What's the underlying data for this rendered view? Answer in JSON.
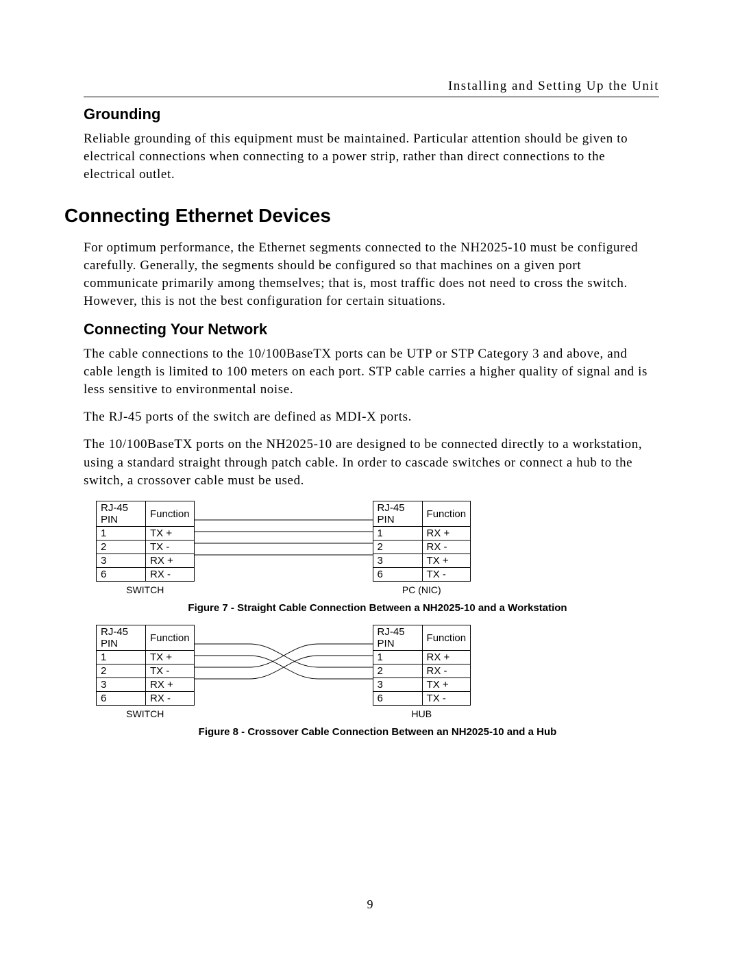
{
  "header": {
    "running_title": "Installing and Setting Up the Unit"
  },
  "sections": {
    "grounding": {
      "title": "Grounding",
      "p1": "Reliable grounding of this equipment must be maintained.  Particular attention should be given to electrical connections when connecting to a power strip, rather than direct connections to the electrical outlet."
    },
    "connecting_devices": {
      "title": "Connecting Ethernet Devices",
      "p1": "For optimum performance, the Ethernet segments connected to the NH2025-10 must be configured carefully.  Generally, the segments should be configured so that machines on a given port communicate primarily among themselves; that is, most traffic does not need to cross the switch.  However, this is not the best configuration for certain situations."
    },
    "connecting_network": {
      "title": "Connecting Your Network",
      "p1": "The cable connections to the 10/100BaseTX ports can be UTP or STP Category 3 and above, and cable length is limited to 100 meters on each port. STP cable carries a higher quality of signal and is less sensitive to environmental noise.",
      "p2": "The RJ-45 ports of the switch are defined as MDI-X ports.",
      "p3": "The 10/100BaseTX ports on the NH2025-10 are designed to be connected directly to a workstation, using a standard straight through patch cable. In order to cascade switches or connect a hub to the switch, a crossover cable must be used."
    }
  },
  "table_headers": {
    "pin": "RJ-45 PIN",
    "fn": "Function"
  },
  "labels": {
    "switch": "SWITCH",
    "pc": "PC (NIC)",
    "hub": "HUB"
  },
  "figures": {
    "fig7": {
      "left": {
        "sub": "SWITCH",
        "rows": [
          {
            "pin": "1",
            "fn": "TX +"
          },
          {
            "pin": "2",
            "fn": "TX -"
          },
          {
            "pin": "3",
            "fn": "RX +"
          },
          {
            "pin": "6",
            "fn": "RX -"
          }
        ]
      },
      "right": {
        "sub": "PC (NIC)",
        "rows": [
          {
            "pin": "1",
            "fn": "RX +"
          },
          {
            "pin": "2",
            "fn": "RX -"
          },
          {
            "pin": "3",
            "fn": "TX +"
          },
          {
            "pin": "6",
            "fn": "TX -"
          }
        ]
      },
      "caption": "Figure 7 - Straight Cable Connection Between a NH2025-10 and a Workstation"
    },
    "fig8": {
      "left": {
        "sub": "SWITCH",
        "rows": [
          {
            "pin": "1",
            "fn": "TX +"
          },
          {
            "pin": "2",
            "fn": "TX -"
          },
          {
            "pin": "3",
            "fn": "RX +"
          },
          {
            "pin": "6",
            "fn": "RX -"
          }
        ]
      },
      "right": {
        "sub": "HUB",
        "rows": [
          {
            "pin": "1",
            "fn": "RX +"
          },
          {
            "pin": "2",
            "fn": "RX -"
          },
          {
            "pin": "3",
            "fn": "TX +"
          },
          {
            "pin": "6",
            "fn": "TX -"
          }
        ]
      },
      "caption": "Figure 8 - Crossover Cable Connection Between an NH2025-10 and a Hub"
    }
  },
  "page_number": "9"
}
